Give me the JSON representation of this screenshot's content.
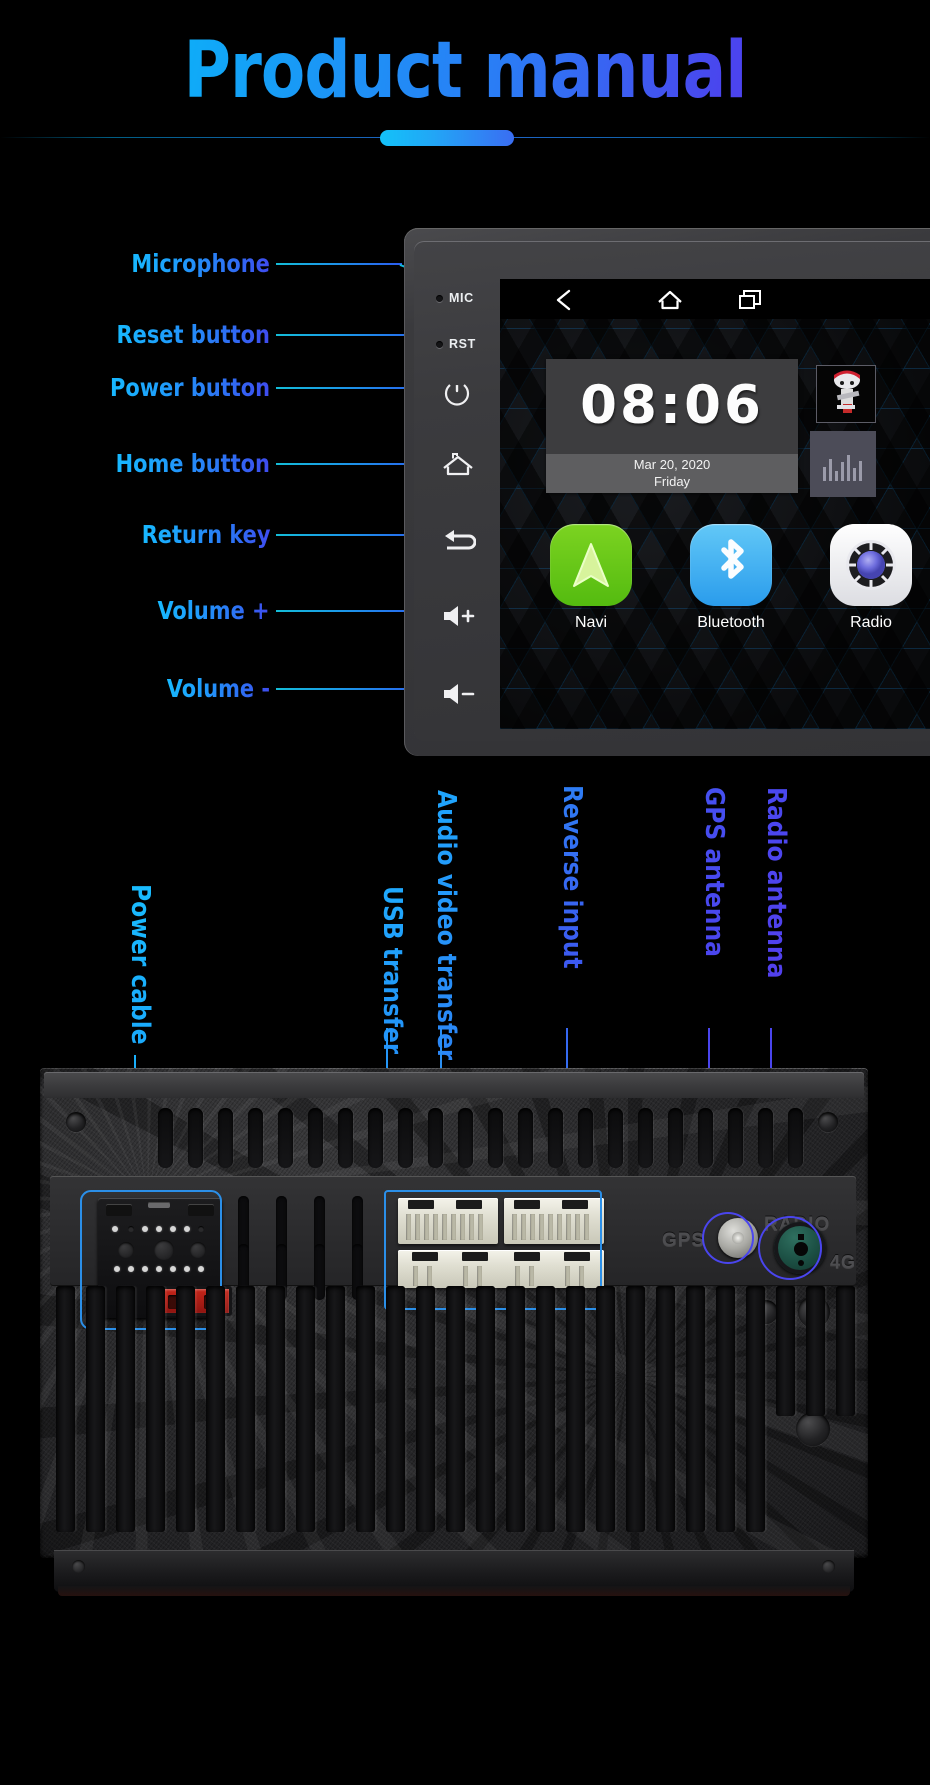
{
  "title": "Product manual",
  "front": {
    "callouts": [
      {
        "label": "Microphone",
        "target": "mic-pinhole"
      },
      {
        "label": "Reset button",
        "target": "rst-pinhole"
      },
      {
        "label": "Power button",
        "target": "power-icon"
      },
      {
        "label": "Home button",
        "target": "home-icon"
      },
      {
        "label": "Return key",
        "target": "return-icon"
      },
      {
        "label": "Volume +",
        "target": "volume-up-icon"
      },
      {
        "label": "Volume -",
        "target": "volume-down-icon"
      }
    ],
    "panel": {
      "mic_label": "MIC",
      "rst_label": "RST"
    },
    "screen": {
      "navbar": [
        "back-icon",
        "home-icon",
        "recents-icon"
      ],
      "clock": {
        "time": "08:06",
        "date": "Mar 20, 2020",
        "day": "Friday"
      },
      "apps": [
        {
          "label": "Navi",
          "icon": "navigation-arrow-icon",
          "color": "#66c81a"
        },
        {
          "label": "Bluetooth",
          "icon": "bluetooth-icon",
          "color": "#3aa8ef"
        },
        {
          "label": "Radio",
          "icon": "radio-knob-icon",
          "color": "#ffffff"
        }
      ]
    }
  },
  "rear": {
    "callouts": [
      {
        "label": "Power cable",
        "target": "iso-power-connector"
      },
      {
        "label": "USB transfer",
        "target": "usb-connector"
      },
      {
        "label": "Audio video transfer",
        "target": "av-connector"
      },
      {
        "label": "Reverse input",
        "target": "reverse-connector"
      },
      {
        "label": "GPS antenna",
        "target": "gps-jack"
      },
      {
        "label": "Radio antenna",
        "target": "radio-jack"
      }
    ],
    "embossed": {
      "gps": "GPS",
      "radio": "RADIO",
      "lte": "4G"
    }
  },
  "colors": {
    "accent_cyan": "#17b9ff",
    "accent_blue": "#2b5cf0",
    "accent_violet": "#4a45ee",
    "highlight_box": "#2b8fe8",
    "highlight_circle": "#4a45ee"
  }
}
